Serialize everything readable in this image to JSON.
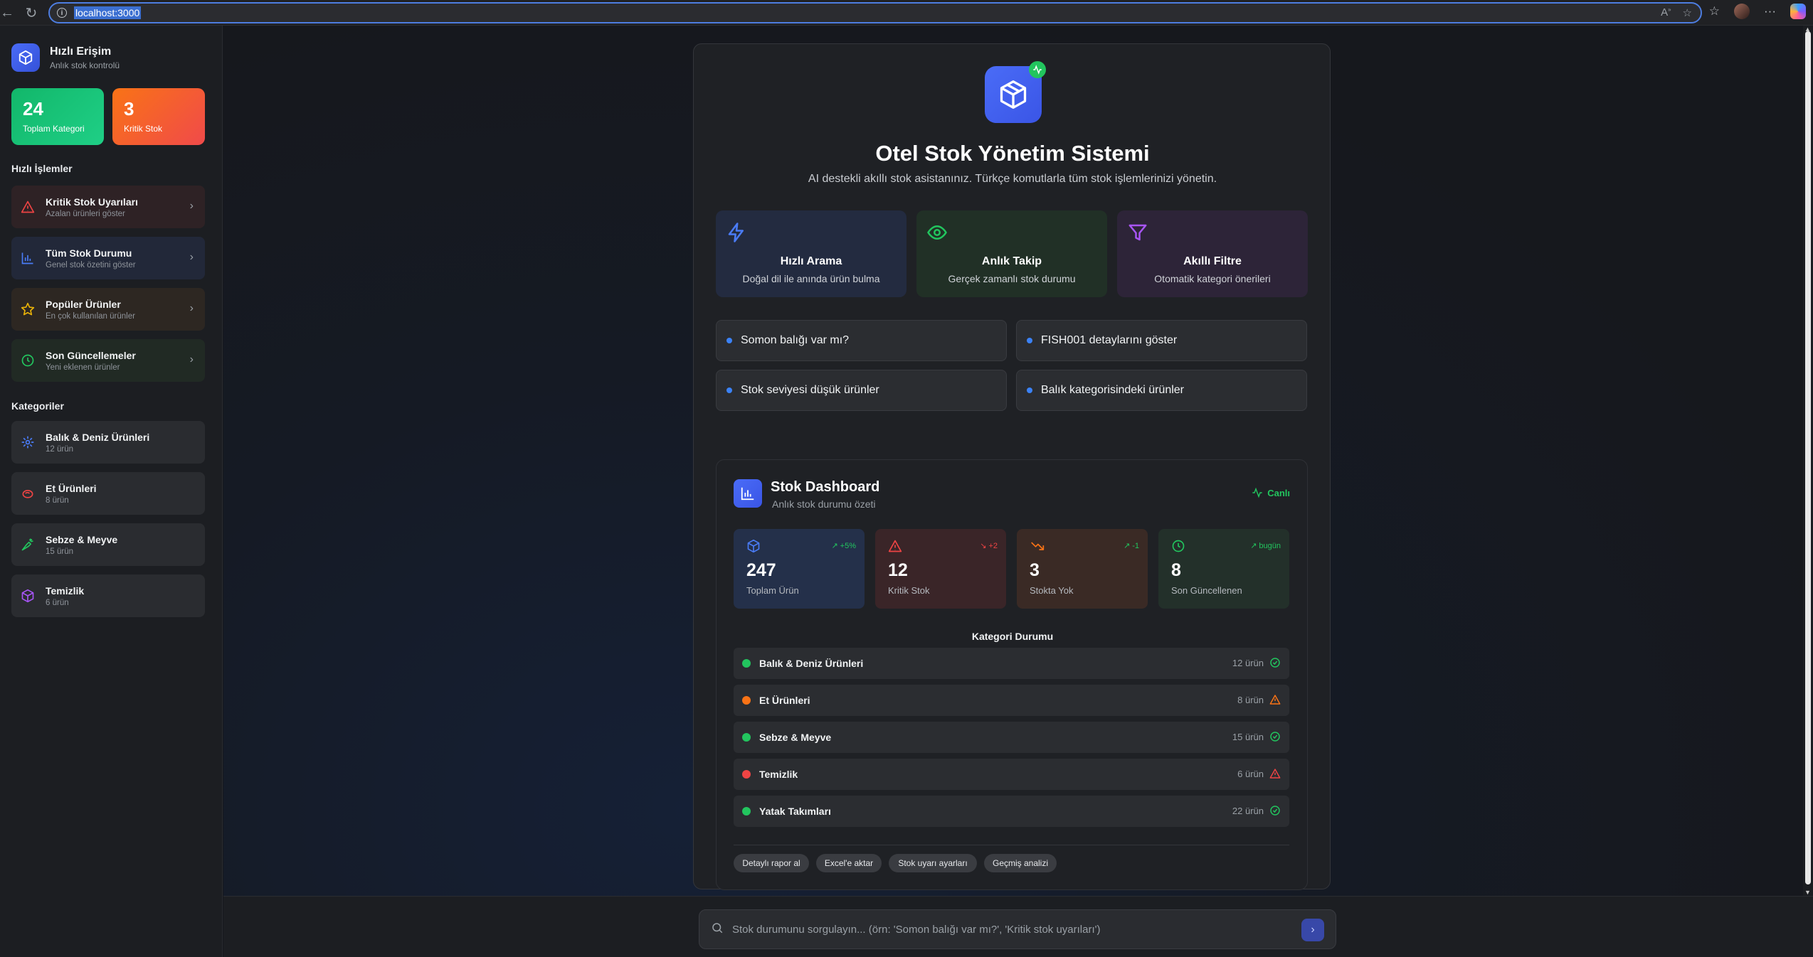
{
  "browser": {
    "url": "localhost:3000"
  },
  "sidebar": {
    "brand_title": "Hızlı Erişim",
    "brand_sub": "Anlık stok kontrolü",
    "stats": [
      {
        "num": "24",
        "label": "Toplam Kategori",
        "color": "#12b76a"
      },
      {
        "num": "3",
        "label": "Kritik Stok",
        "color": "#f97316"
      }
    ],
    "quick_title": "Hızlı İşlemler",
    "quick_actions": [
      {
        "title": "Kritik Stok Uyarıları",
        "sub": "Azalan ürünleri göster",
        "icon": "warning-icon"
      },
      {
        "title": "Tüm Stok Durumu",
        "sub": "Genel stok özetini göster",
        "icon": "bar-chart-icon"
      },
      {
        "title": "Popüler Ürünler",
        "sub": "En çok kullanılan ürünler",
        "icon": "star-icon"
      },
      {
        "title": "Son Güncellemeler",
        "sub": "Yeni eklenen ürünler",
        "icon": "clock-icon"
      }
    ],
    "categories_title": "Kategoriler",
    "categories": [
      {
        "title": "Balık & Deniz Ürünleri",
        "sub": "12 ürün",
        "icon": "fish-icon"
      },
      {
        "title": "Et Ürünleri",
        "sub": "8 ürün",
        "icon": "meat-icon"
      },
      {
        "title": "Sebze & Meyve",
        "sub": "15 ürün",
        "icon": "carrot-icon"
      },
      {
        "title": "Temizlik",
        "sub": "6 ürün",
        "icon": "box-icon"
      }
    ]
  },
  "hero": {
    "title": "Otel Stok Yönetim Sistemi",
    "subtitle": "AI destekli akıllı stok asistanınız. Türkçe komutlarla tüm stok işlemlerinizi yönetin."
  },
  "features": [
    {
      "title": "Hızlı Arama",
      "sub": "Doğal dil ile anında ürün bulma",
      "icon": "lightning-icon"
    },
    {
      "title": "Anlık Takip",
      "sub": "Gerçek zamanlı stok durumu",
      "icon": "eye-icon"
    },
    {
      "title": "Akıllı Filtre",
      "sub": "Otomatik kategori önerileri",
      "icon": "filter-icon"
    }
  ],
  "suggestions": [
    "Somon balığı var mı?",
    "FISH001 detaylarını göster",
    "Stok seviyesi düşük ürünler",
    "Balık kategorisindeki ürünler"
  ],
  "dashboard": {
    "title": "Stok Dashboard",
    "subtitle": "Anlık stok durumu özeti",
    "live_label": "Canlı",
    "metrics": [
      {
        "num": "247",
        "label": "Toplam Ürün",
        "trend": "+5%",
        "trend_color": "#22c55e",
        "icon": "box-icon"
      },
      {
        "num": "12",
        "label": "Kritik Stok",
        "trend": "+2",
        "trend_color": "#ef4444",
        "icon": "warning-icon"
      },
      {
        "num": "3",
        "label": "Stokta Yok",
        "trend": "-1",
        "trend_color": "#22c55e",
        "icon": "trend-down-icon"
      },
      {
        "num": "8",
        "label": "Son Güncellenen",
        "trend": "bugün",
        "trend_color": "#22c55e",
        "icon": "clock-icon"
      }
    ],
    "category_status_title": "Kategori Durumu",
    "category_status": [
      {
        "name": "Balık & Deniz Ürünleri",
        "count": "12 ürün",
        "status": "ok",
        "color": "#22c55e"
      },
      {
        "name": "Et Ürünleri",
        "count": "8 ürün",
        "status": "warn",
        "color": "#f97316"
      },
      {
        "name": "Sebze & Meyve",
        "count": "15 ürün",
        "status": "ok",
        "color": "#22c55e"
      },
      {
        "name": "Temizlik",
        "count": "6 ürün",
        "status": "critical",
        "color": "#ef4444"
      },
      {
        "name": "Yatak Takımları",
        "count": "22 ürün",
        "status": "ok",
        "color": "#22c55e"
      }
    ],
    "chips": [
      "Detaylı rapor al",
      "Excel'e aktar",
      "Stok uyarı ayarları",
      "Geçmiş analizi"
    ]
  },
  "query": {
    "placeholder": "Stok durumunu sorgulayın... (örn: 'Somon balığı var mı?', 'Kritik stok uyarıları')"
  }
}
